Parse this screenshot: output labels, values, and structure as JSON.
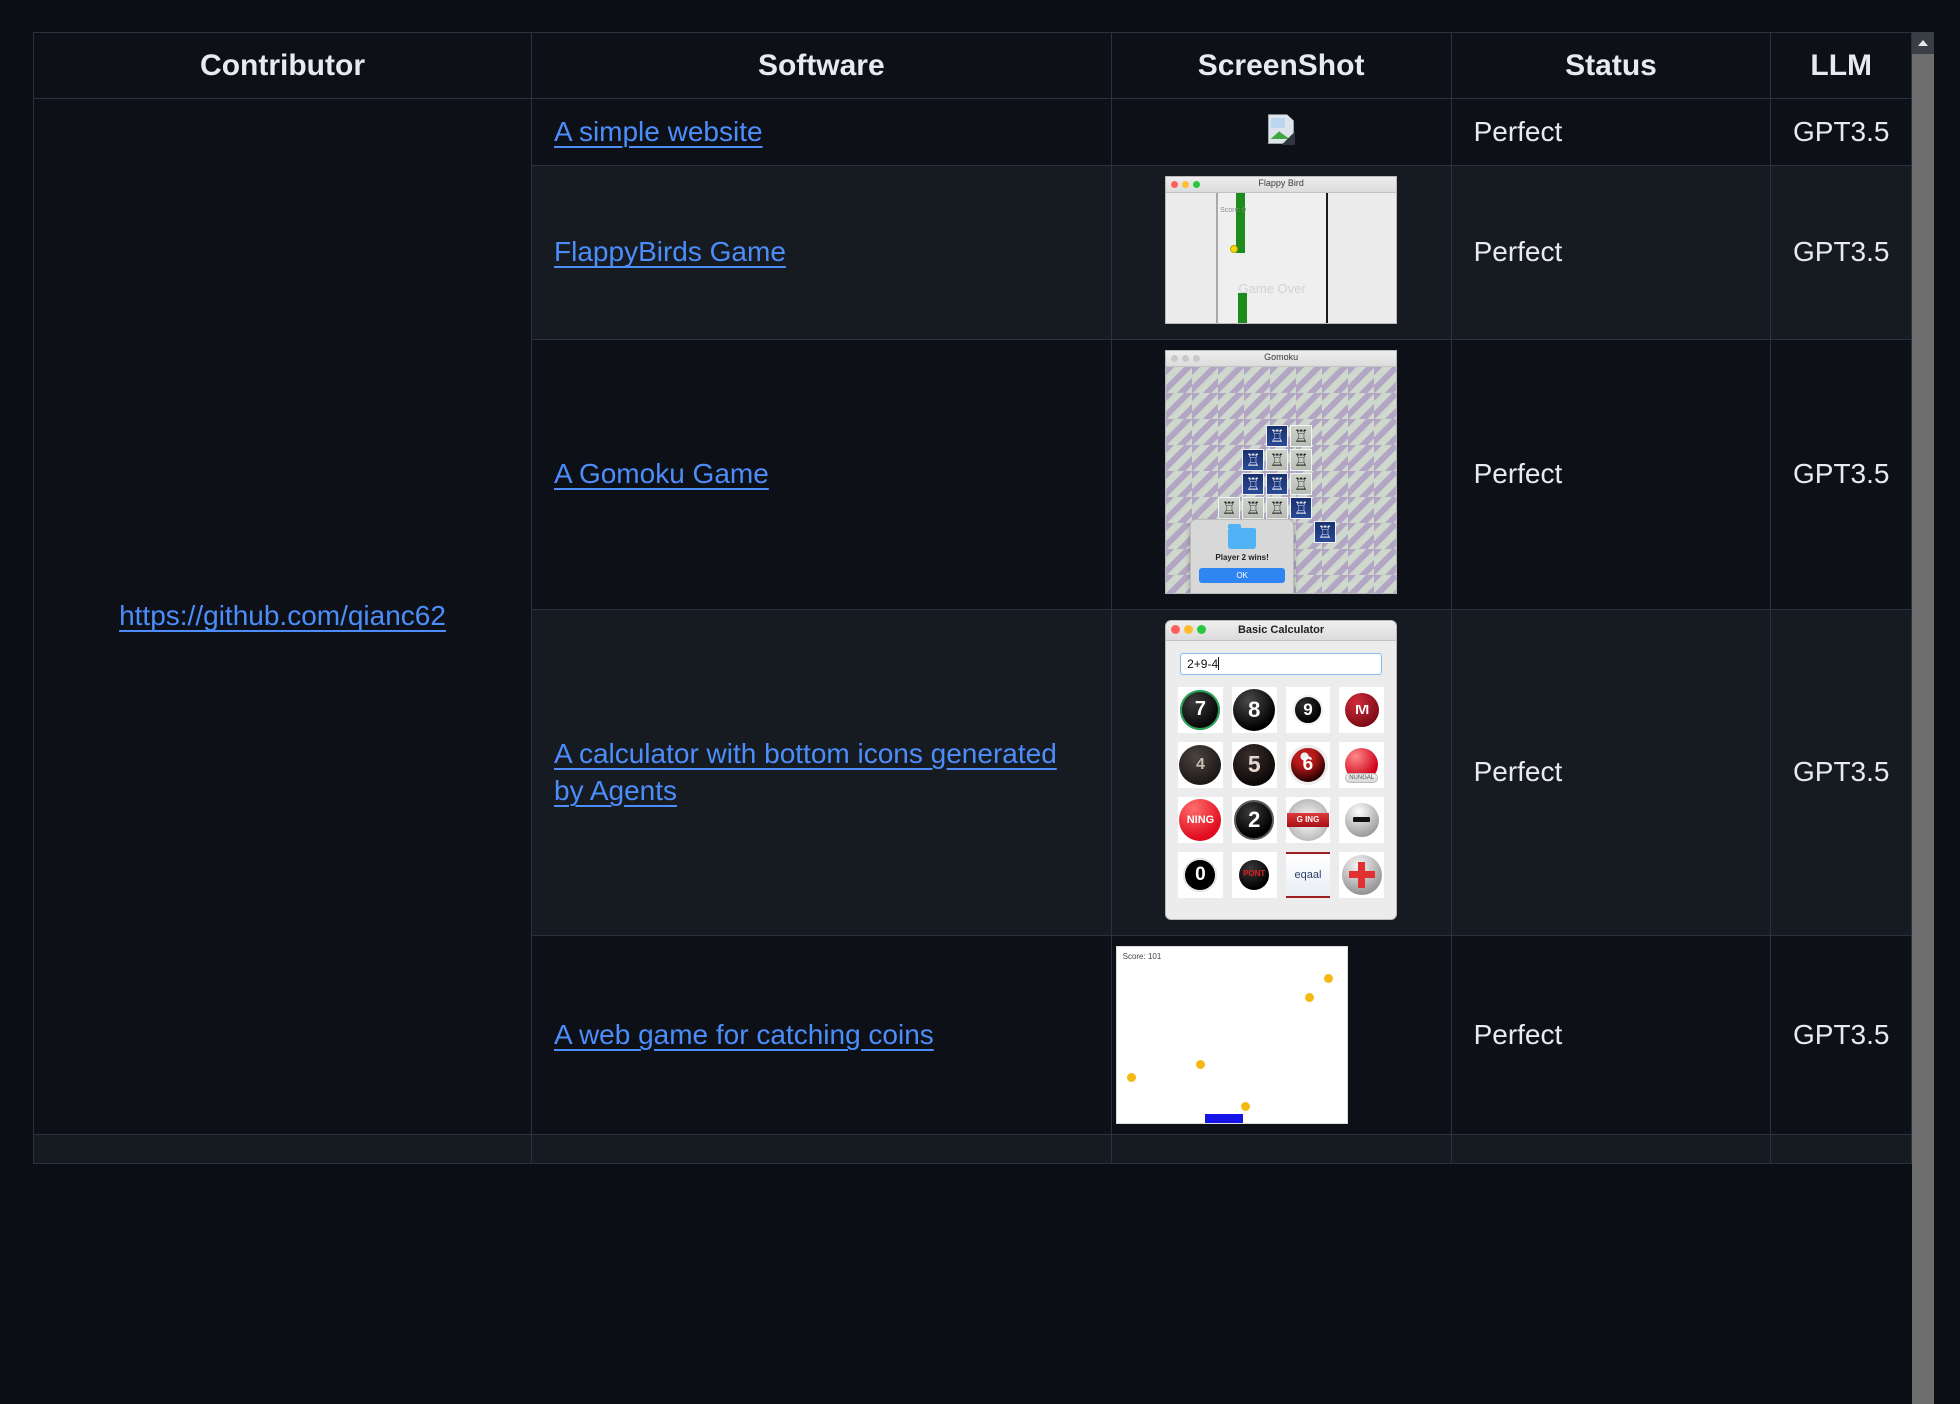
{
  "table": {
    "headers": [
      "Contributor",
      "Software",
      "ScreenShot",
      "Status",
      "LLM"
    ],
    "contributor": "https://github.com/qianc62",
    "rows": [
      {
        "software": "A simple website",
        "screenshot": "broken-image-icon",
        "status": "Perfect",
        "llm": "GPT3.5"
      },
      {
        "software": "FlappyBirds Game",
        "screenshot": "flappy-bird-window",
        "status": "Perfect",
        "llm": "GPT3.5",
        "shot": {
          "title": "Flappy Bird",
          "score": "Score: 0",
          "gameover": "Game Over"
        }
      },
      {
        "software": "A Gomoku Game",
        "screenshot": "gomoku-window",
        "status": "Perfect",
        "llm": "GPT3.5",
        "shot": {
          "title": "Gomoku",
          "dialog_message": "Player 2 wins!",
          "dialog_button": "OK"
        }
      },
      {
        "software": "A calculator with bottom icons generated by Agents",
        "screenshot": "calculator-window",
        "status": "Perfect",
        "llm": "GPT3.5",
        "shot": {
          "title": "Basic Calculator",
          "display": "2+9-4",
          "keys": [
            "7",
            "8",
            "9",
            "IVI",
            "4",
            "5",
            "6",
            "NUNGAL",
            "NING",
            "2",
            "G ING",
            "−",
            "0",
            "PONT",
            "eqaal",
            "+"
          ]
        }
      },
      {
        "software": "A web game for catching coins",
        "screenshot": "coin-game-window",
        "status": "Perfect",
        "llm": "GPT3.5",
        "shot": {
          "score": "Score: 101"
        }
      }
    ]
  },
  "colors": {
    "page_background": "#0b0e14",
    "row_odd": "#0d1117",
    "row_even": "#161b22",
    "border": "#2b3140",
    "link": "#4c8dfa",
    "text": "#e8eaf0",
    "scrollbar_thumb": "#6e6e6e"
  }
}
